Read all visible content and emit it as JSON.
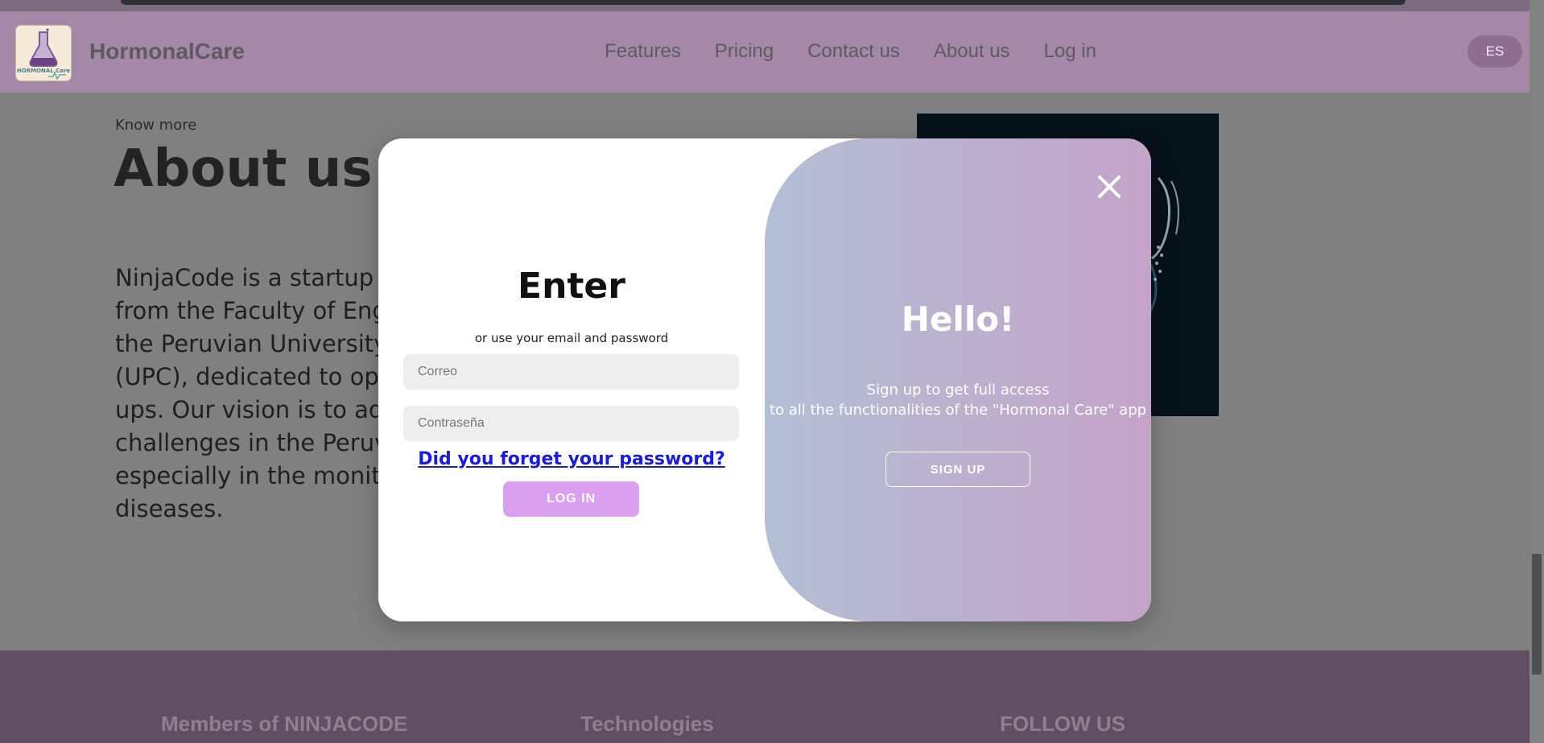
{
  "navbar": {
    "brand": "HormonalCare",
    "logo_text": "HORMONAL Care",
    "links": [
      "Features",
      "Pricing",
      "Contact us",
      "About us",
      "Log in"
    ],
    "lang_button": "ES"
  },
  "about": {
    "kicker": "Know more",
    "title": "About us",
    "paragraph_lines": [
      "NinjaCode is a startup m",
      "from the Faculty of Engi",
      "the Peruvian University",
      "(UPC), dedicated to opti",
      "ups. Our vision is to add",
      "challenges in the Peruvi",
      "especially in the monito",
      "diseases."
    ]
  },
  "footer": {
    "col1": "Members of NINJACODE",
    "col2": "Technologies",
    "col3": "FOLLOW US"
  },
  "modal": {
    "title": "Enter",
    "hint": "or use your email and password",
    "email_placeholder": "Correo",
    "password_placeholder": "Contraseña",
    "forgot_link": "Did you forget your password?",
    "login_button": "LOG IN",
    "hello": "Hello!",
    "signup_line1": "Sign up to get full access",
    "signup_line2": "to all the functionalities of the \"Hormonal Care\" app",
    "signup_button": "SIGN UP",
    "close_icon": "close-icon",
    "colors": {
      "gradient_start": "#b3bfd5",
      "gradient_end": "#c4a3c8",
      "login_button": "#dca0f0",
      "forgot_link": "#1a1ae0"
    }
  }
}
